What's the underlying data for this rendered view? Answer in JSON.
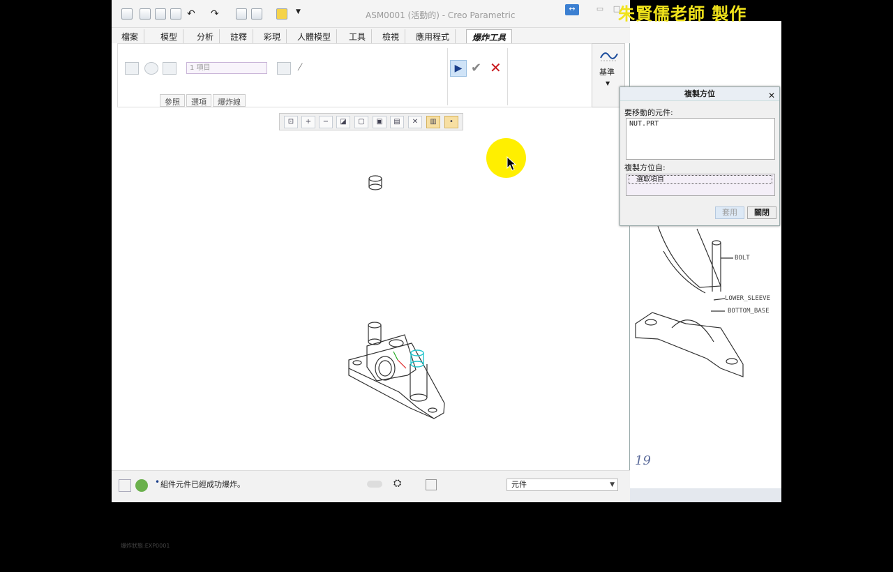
{
  "window": {
    "title": "ASM0001 (活動的) - Creo Parametric",
    "watermark": "朱賢儒老師 製作"
  },
  "menubar": {
    "items": [
      "檔案",
      "模型",
      "分析",
      "註釋",
      "彩現",
      "人體模型",
      "工具",
      "檢視",
      "應用程式",
      "爆炸工具"
    ],
    "active": "爆炸工具"
  },
  "ribbon": {
    "items_field": "1 項目",
    "tabs": [
      "參照",
      "選項",
      "爆炸線"
    ],
    "datum_label": "基準"
  },
  "graphics": {
    "explode_state": "爆炸狀態:EXP0001"
  },
  "statusbar": {
    "message": "組件元件已經成功爆炸。",
    "filter": "元件"
  },
  "dialog": {
    "title": "複製方位",
    "moving_label": "要移動的元件:",
    "moving_items": [
      "NUT.PRT"
    ],
    "from_label": "複製方位自:",
    "from_select": "選取項目",
    "apply": "套用",
    "close": "關閉"
  },
  "drawing": {
    "labels": [
      "BOLT",
      "LOWER_SLEEVE",
      "BOTTOM_BASE"
    ],
    "page": "19"
  },
  "colors": {
    "accent": "#3b7fd1",
    "cancel": "#c8161b",
    "highlight": "#ffef00",
    "watermark": "#f1e31b"
  }
}
